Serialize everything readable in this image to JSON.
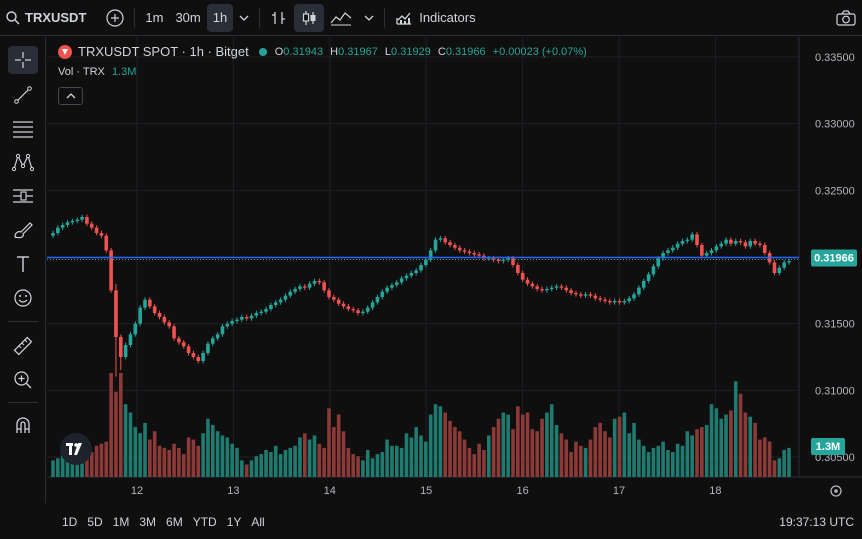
{
  "topbar": {
    "symbol": "TRXUSDT",
    "intervals": [
      "1m",
      "30m",
      "1h"
    ],
    "active_interval": "1h",
    "indicators_label": "Indicators"
  },
  "legend": {
    "title": "TRXUSDT SPOT · 1h · Bitget",
    "o_label": "O",
    "o": "0.31943",
    "h_label": "H",
    "h": "0.31967",
    "l_label": "L",
    "l": "0.31929",
    "c_label": "C",
    "c": "0.31966",
    "change": "+0.00023 (+0.07%)",
    "vol_label": "Vol · TRX",
    "vol_value": "1.3M"
  },
  "bottombar": {
    "ranges": [
      "1D",
      "5D",
      "1M",
      "3M",
      "6M",
      "YTD",
      "1Y",
      "All"
    ],
    "time": "19:37:13 UTC"
  },
  "colors": {
    "up": "#26a69a",
    "down": "#ef5350",
    "hline": "#2962ff",
    "bg": "#0f0f0f",
    "grid": "#1c1f26"
  },
  "chart_data": {
    "type": "candlestick",
    "title": "TRXUSDT SPOT · 1h · Bitget",
    "x_ticks": [
      "12",
      "13",
      "14",
      "15",
      "16",
      "17",
      "18"
    ],
    "y_ticks": [
      "0.33500",
      "0.33000",
      "0.32500",
      "0.32000",
      "0.31500",
      "0.31000",
      "0.30500"
    ],
    "ylim": [
      0.3035,
      0.3365
    ],
    "price_label": "0.31966",
    "horizontal_line": 0.31996,
    "volume_label": "1.3M",
    "close": [
      0.3218,
      0.3222,
      0.3224,
      0.3226,
      0.3227,
      0.3228,
      0.323,
      0.3225,
      0.3222,
      0.3218,
      0.3216,
      0.3205,
      0.3175,
      0.314,
      0.3125,
      0.3134,
      0.3142,
      0.315,
      0.3162,
      0.3168,
      0.3163,
      0.3158,
      0.3155,
      0.3151,
      0.3148,
      0.3139,
      0.3136,
      0.3133,
      0.3128,
      0.3125,
      0.3122,
      0.3128,
      0.3135,
      0.3139,
      0.3142,
      0.3148,
      0.315,
      0.3152,
      0.3153,
      0.3155,
      0.3154,
      0.3156,
      0.3158,
      0.3159,
      0.3161,
      0.3164,
      0.3166,
      0.3168,
      0.3171,
      0.3174,
      0.3176,
      0.3178,
      0.3177,
      0.318,
      0.3182,
      0.3181,
      0.3175,
      0.317,
      0.3168,
      0.3165,
      0.3163,
      0.3161,
      0.316,
      0.3158,
      0.3159,
      0.3162,
      0.3166,
      0.317,
      0.3174,
      0.3177,
      0.3179,
      0.3181,
      0.3184,
      0.3186,
      0.3188,
      0.319,
      0.3194,
      0.3198,
      0.3205,
      0.3213,
      0.3214,
      0.3211,
      0.3209,
      0.3207,
      0.3205,
      0.3204,
      0.3203,
      0.3202,
      0.3201,
      0.3199,
      0.3199,
      0.3198,
      0.3197,
      0.3198,
      0.3199,
      0.3194,
      0.3188,
      0.3183,
      0.318,
      0.3178,
      0.3176,
      0.3175,
      0.3176,
      0.3177,
      0.3178,
      0.3177,
      0.3175,
      0.3173,
      0.3172,
      0.3171,
      0.3172,
      0.3171,
      0.3169,
      0.3168,
      0.3167,
      0.3166,
      0.3167,
      0.3166,
      0.3167,
      0.3169,
      0.3172,
      0.3177,
      0.3182,
      0.3187,
      0.3193,
      0.3199,
      0.3203,
      0.3205,
      0.3207,
      0.321,
      0.3212,
      0.3213,
      0.3217,
      0.3209,
      0.3201,
      0.3203,
      0.3205,
      0.3208,
      0.321,
      0.3213,
      0.321,
      0.3212,
      0.3211,
      0.3208,
      0.3212,
      0.321,
      0.3209,
      0.3203,
      0.3196,
      0.3188,
      0.3192,
      0.3196,
      0.3197
    ],
    "volume": [
      0.16,
      0.18,
      0.26,
      0.2,
      0.22,
      0.24,
      0.28,
      0.22,
      0.24,
      0.3,
      0.32,
      0.34,
      1.0,
      0.82,
      1.0,
      0.7,
      0.62,
      0.48,
      0.42,
      0.52,
      0.36,
      0.44,
      0.3,
      0.28,
      0.26,
      0.32,
      0.28,
      0.22,
      0.38,
      0.36,
      0.3,
      0.42,
      0.56,
      0.5,
      0.44,
      0.4,
      0.38,
      0.32,
      0.28,
      0.16,
      0.12,
      0.16,
      0.2,
      0.22,
      0.26,
      0.24,
      0.3,
      0.22,
      0.26,
      0.28,
      0.3,
      0.38,
      0.42,
      0.36,
      0.4,
      0.32,
      0.28,
      0.66,
      0.48,
      0.6,
      0.44,
      0.28,
      0.22,
      0.2,
      0.16,
      0.26,
      0.18,
      0.22,
      0.24,
      0.36,
      0.3,
      0.3,
      0.28,
      0.42,
      0.38,
      0.48,
      0.4,
      0.34,
      0.6,
      0.7,
      0.68,
      0.62,
      0.54,
      0.48,
      0.44,
      0.36,
      0.28,
      0.22,
      0.32,
      0.26,
      0.4,
      0.48,
      0.56,
      0.62,
      0.6,
      0.46,
      0.68,
      0.6,
      0.62,
      0.46,
      0.44,
      0.56,
      0.62,
      0.7,
      0.5,
      0.42,
      0.36,
      0.24,
      0.34,
      0.3,
      0.28,
      0.36,
      0.48,
      0.52,
      0.44,
      0.38,
      0.56,
      0.58,
      0.62,
      0.42,
      0.52,
      0.36,
      0.3,
      0.24,
      0.28,
      0.3,
      0.34,
      0.26,
      0.24,
      0.32,
      0.3,
      0.44,
      0.4,
      0.46,
      0.48,
      0.5,
      0.7,
      0.66,
      0.56,
      0.6,
      0.64,
      0.92,
      0.8,
      0.62,
      0.58,
      0.52,
      0.36,
      0.38,
      0.34,
      0.16,
      0.18,
      0.26,
      0.28,
      0.3,
      0.32,
      0.26,
      0.38,
      0.88,
      0.36,
      0.32,
      0.34,
      0.38
    ]
  }
}
